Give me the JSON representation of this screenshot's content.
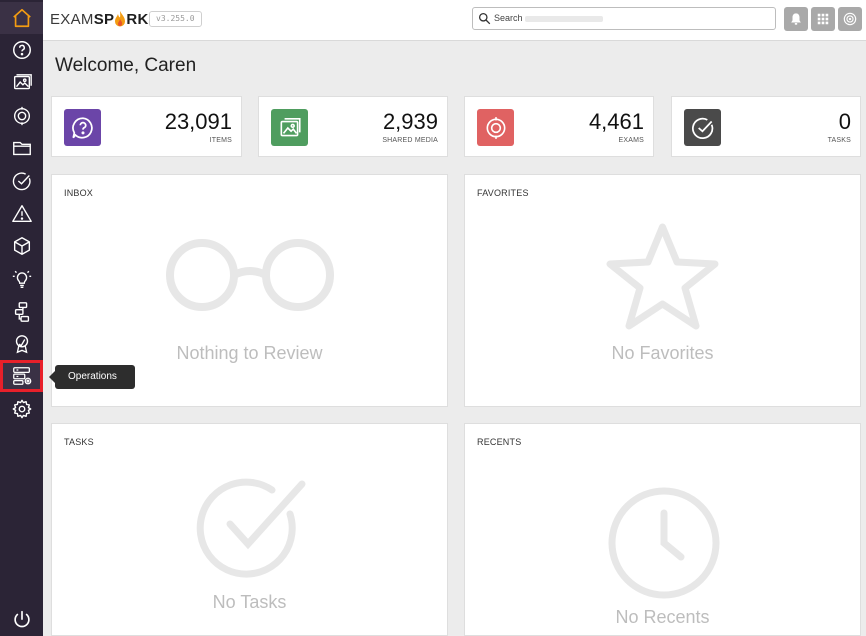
{
  "app": {
    "logo_exam": "EXAM",
    "logo_sp": "SP",
    "logo_rk": "RK",
    "version": "v3.255.0",
    "brand_color": "#f39c12"
  },
  "header": {
    "search_placeholder": "Search",
    "icons": [
      "bell-icon",
      "apps-grid-icon",
      "user-avatar-icon"
    ]
  },
  "sidebar": {
    "items": [
      {
        "name": "home",
        "icon": "home-icon"
      },
      {
        "name": "items",
        "icon": "question-bubble-icon"
      },
      {
        "name": "media",
        "icon": "media-icon"
      },
      {
        "name": "exams",
        "icon": "target-icon"
      },
      {
        "name": "folders",
        "icon": "folder-icon"
      },
      {
        "name": "tasks",
        "icon": "check-circle-icon"
      },
      {
        "name": "alerts",
        "icon": "warning-icon"
      },
      {
        "name": "packages",
        "icon": "cube-icon"
      },
      {
        "name": "ideas",
        "icon": "lightbulb-icon"
      },
      {
        "name": "workflow",
        "icon": "workflow-icon"
      },
      {
        "name": "certificates",
        "icon": "award-icon"
      },
      {
        "name": "operations",
        "icon": "operations-icon",
        "active": true
      },
      {
        "name": "settings",
        "icon": "gear-icon"
      }
    ],
    "power_icon": "power-icon",
    "tooltip": "Operations"
  },
  "main": {
    "welcome": "Welcome, Caren",
    "stats": [
      {
        "value": "23,091",
        "label": "ITEMS",
        "color": "#6b45a8",
        "icon": "question-bubble-icon"
      },
      {
        "value": "2,939",
        "label": "SHARED MEDIA",
        "color": "#4f9d5f",
        "icon": "media-icon"
      },
      {
        "value": "4,461",
        "label": "EXAMS",
        "color": "#e06262",
        "icon": "target-icon"
      },
      {
        "value": "0",
        "label": "TASKS",
        "color": "#4a4a4a",
        "icon": "check-circle-icon"
      }
    ],
    "panels": {
      "inbox": {
        "title": "INBOX",
        "empty": "Nothing to Review",
        "icon": "glasses-icon"
      },
      "favorites": {
        "title": "FAVORITES",
        "empty": "No Favorites",
        "icon": "star-icon"
      },
      "tasks": {
        "title": "TASKS",
        "empty": "No Tasks",
        "icon": "check-circle-icon"
      },
      "recents": {
        "title": "RECENTS",
        "empty": "No Recents",
        "icon": "clock-icon"
      }
    }
  }
}
